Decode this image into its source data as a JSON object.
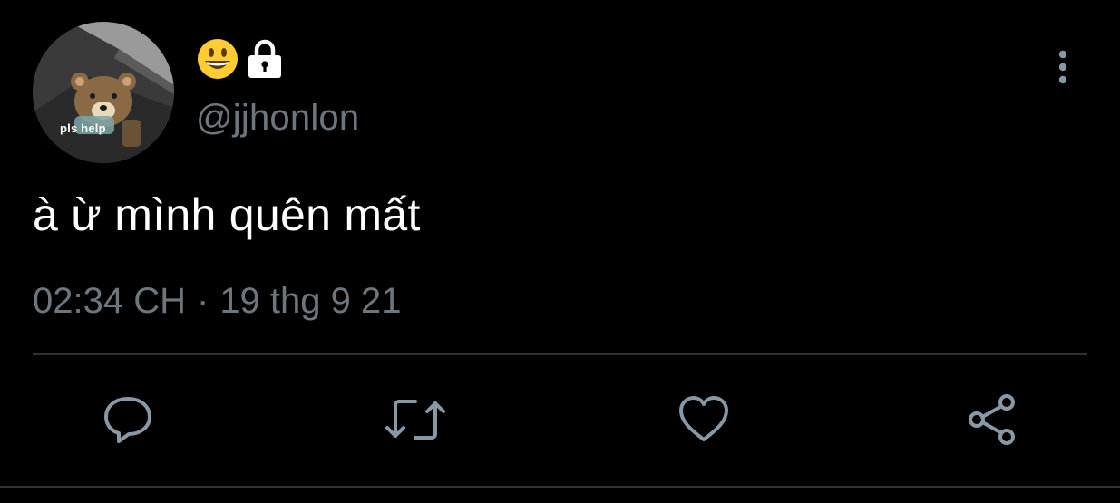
{
  "avatar": {
    "caption": "pls help"
  },
  "user": {
    "display_name_icons": [
      "grinning-face-emoji",
      "lock-icon"
    ],
    "handle": "@jjhonlon"
  },
  "tweet": {
    "text": "à ừ mình quên mất",
    "time": "02:34 CH",
    "separator": "·",
    "date": "19 thg 9 21"
  },
  "actions": [
    {
      "name": "reply",
      "icon": "reply-icon"
    },
    {
      "name": "retweet",
      "icon": "retweet-icon"
    },
    {
      "name": "like",
      "icon": "heart-icon"
    },
    {
      "name": "share",
      "icon": "share-icon"
    }
  ],
  "colors": {
    "background": "#000000",
    "text_primary": "#ffffff",
    "text_secondary": "#6e767d",
    "icon": "#8899a6",
    "divider": "#2f3336"
  }
}
